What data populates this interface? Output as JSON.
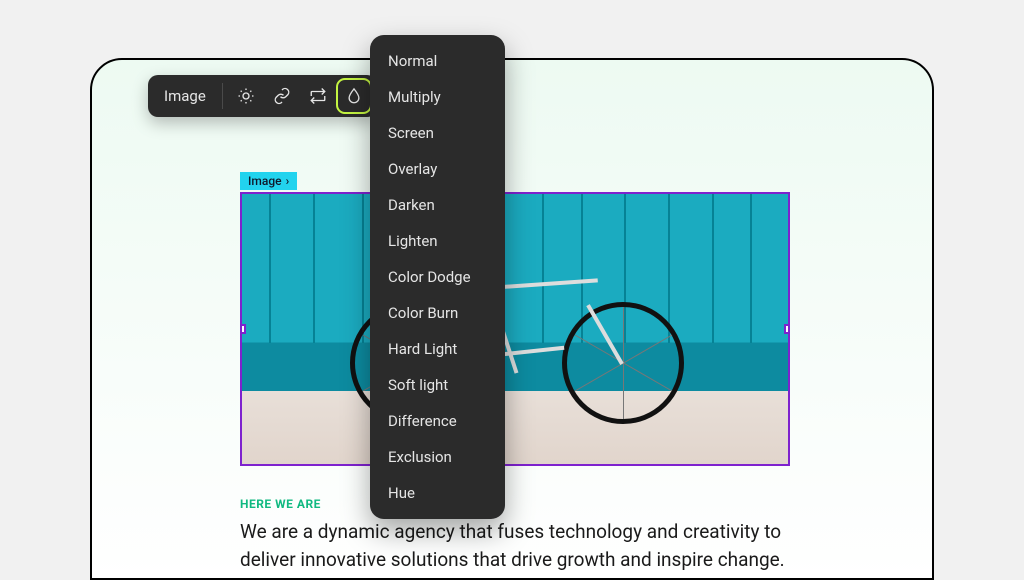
{
  "toolbar": {
    "label": "Image"
  },
  "selection_tag": {
    "label": "Image"
  },
  "blend_modes": [
    "Normal",
    "Multiply",
    "Screen",
    "Overlay",
    "Darken",
    "Lighten",
    "Color Dodge",
    "Color Burn",
    "Hard Light",
    "Soft light",
    "Difference",
    "Exclusion",
    "Hue"
  ],
  "content": {
    "eyebrow": "HERE WE ARE",
    "body": "We are a dynamic agency that fuses technology and creativity to deliver innovative solutions that drive growth and inspire change."
  },
  "colors": {
    "selection": "#7e22ce",
    "tag_bg": "#22d3ee",
    "active_outline": "#c4f542",
    "accent": "#10b981"
  }
}
